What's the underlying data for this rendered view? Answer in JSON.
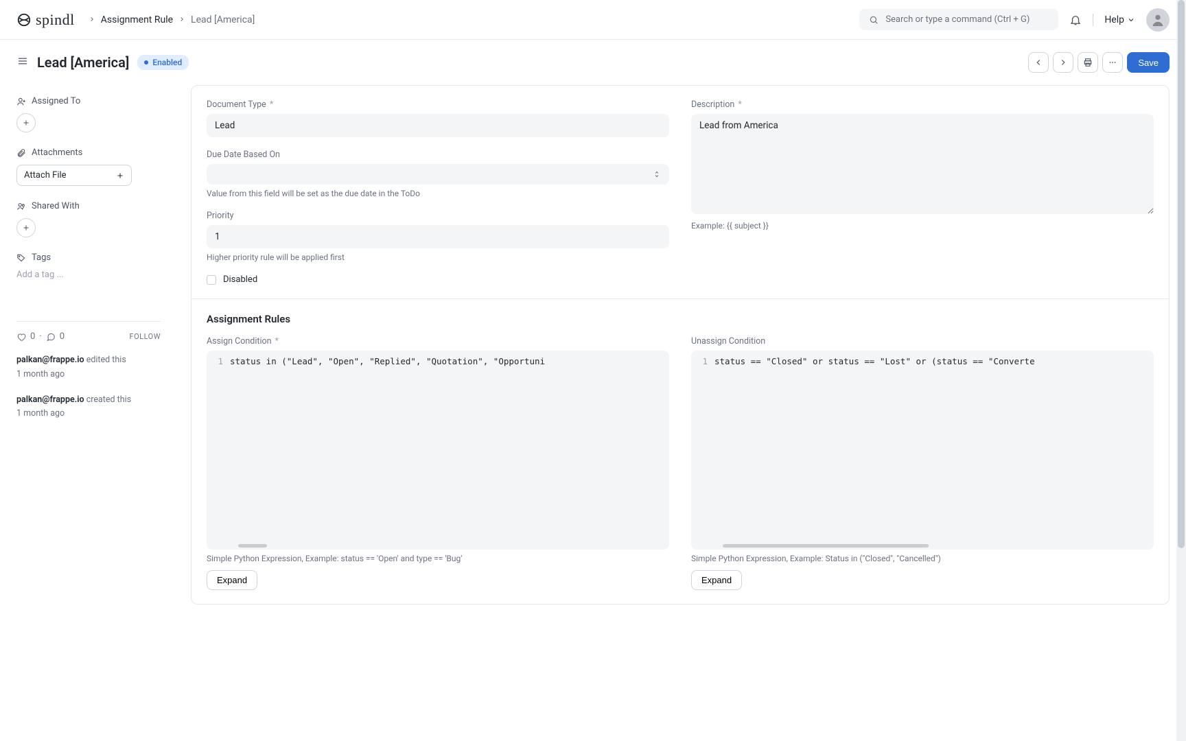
{
  "brand": "spindl",
  "breadcrumb": {
    "parent": "Assignment Rule",
    "current": "Lead [America]"
  },
  "search": {
    "placeholder": "Search or type a command (Ctrl + G)"
  },
  "help_label": "Help",
  "page": {
    "title": "Lead [America]",
    "status": "Enabled",
    "save_label": "Save"
  },
  "sidebar": {
    "assigned_to": "Assigned To",
    "attachments": "Attachments",
    "attach_file": "Attach File",
    "shared_with": "Shared With",
    "tags": "Tags",
    "add_tag": "Add a tag ...",
    "likes": "0",
    "comments": "0",
    "follow": "FOLLOW",
    "timeline": [
      {
        "user": "palkan@frappe.io",
        "action": "edited this",
        "time": "1 month ago"
      },
      {
        "user": "palkan@frappe.io",
        "action": "created this",
        "time": "1 month ago"
      }
    ]
  },
  "form": {
    "document_type": {
      "label": "Document Type",
      "required": true,
      "value": "Lead"
    },
    "due_date": {
      "label": "Due Date Based On",
      "value": "",
      "help": "Value from this field will be set as the due date in the ToDo"
    },
    "priority": {
      "label": "Priority",
      "value": "1",
      "help": "Higher priority rule will be applied first"
    },
    "disabled": {
      "label": "Disabled",
      "checked": false
    },
    "description": {
      "label": "Description",
      "required": true,
      "value": "Lead from America",
      "help": "Example: {{ subject }}"
    }
  },
  "rules": {
    "section_title": "Assignment Rules",
    "assign": {
      "label": "Assign Condition",
      "required": true,
      "code": "status in (\"Lead\", \"Open\", \"Replied\", \"Quotation\", \"Opportuni",
      "help": "Simple Python Expression, Example: status == 'Open' and type == 'Bug'",
      "expand": "Expand"
    },
    "unassign": {
      "label": "Unassign Condition",
      "required": false,
      "code": "status == \"Closed\" or status == \"Lost\" or (status == \"Converte",
      "help": "Simple Python Expression, Example: Status in (\"Closed\", \"Cancelled\")",
      "expand": "Expand"
    }
  }
}
